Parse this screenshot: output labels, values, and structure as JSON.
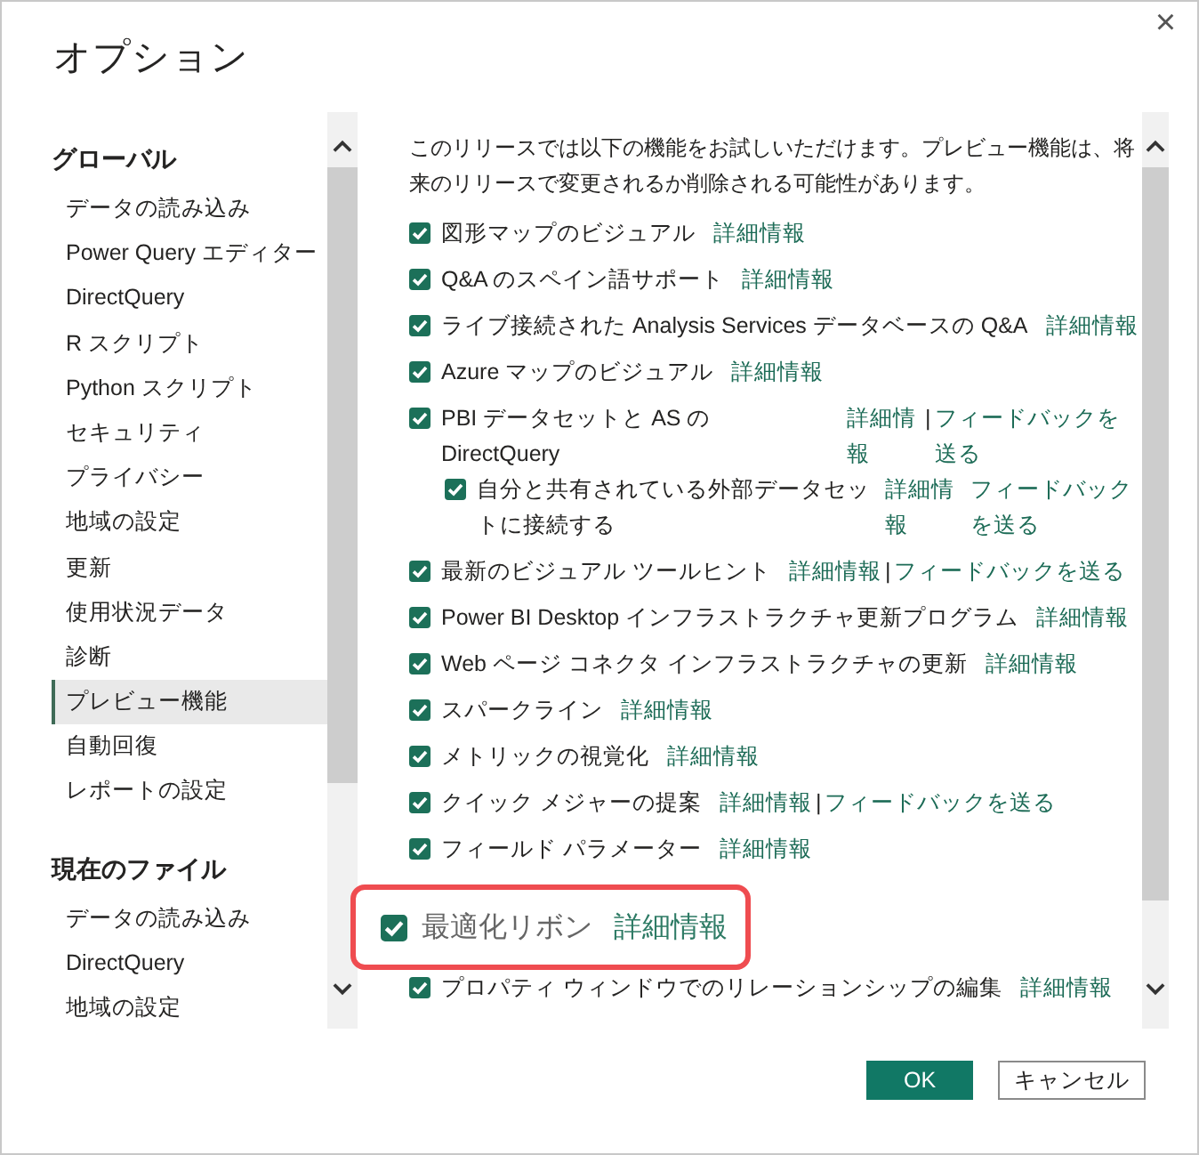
{
  "window": {
    "title": "オプション",
    "close": "×"
  },
  "sidebar": {
    "sections": [
      {
        "title": "グローバル",
        "items": [
          {
            "label": "データの読み込み",
            "selected": false
          },
          {
            "label": "Power Query エディター",
            "selected": false
          },
          {
            "label": "DirectQuery",
            "selected": false
          },
          {
            "label": "R スクリプト",
            "selected": false
          },
          {
            "label": "Python スクリプト",
            "selected": false
          },
          {
            "label": "セキュリティ",
            "selected": false
          },
          {
            "label": "プライバシー",
            "selected": false
          },
          {
            "label": "地域の設定",
            "selected": false
          },
          {
            "label": "更新",
            "selected": false
          },
          {
            "label": "使用状況データ",
            "selected": false
          },
          {
            "label": "診断",
            "selected": false
          },
          {
            "label": "プレビュー機能",
            "selected": true
          },
          {
            "label": "自動回復",
            "selected": false
          },
          {
            "label": "レポートの設定",
            "selected": false
          }
        ]
      },
      {
        "title": "現在のファイル",
        "items": [
          {
            "label": "データの読み込み",
            "selected": false
          },
          {
            "label": "DirectQuery",
            "selected": false
          },
          {
            "label": "地域の設定",
            "selected": false
          }
        ]
      }
    ]
  },
  "content": {
    "intro": "このリリースでは以下の機能をお試しいただけます。プレビュー機能は、将来のリリースで変更されるか削除される可能性があります。",
    "features": [
      {
        "label": "図形マップのビジュアル",
        "checked": true,
        "kind": "inline",
        "links": [
          "詳細情報"
        ]
      },
      {
        "label": "Q&A のスペイン語サポート",
        "checked": true,
        "kind": "inline",
        "links": [
          "詳細情報"
        ]
      },
      {
        "label": "ライブ接続された Analysis Services データベースの Q&A",
        "checked": true,
        "kind": "inline",
        "links": [
          "詳細情報"
        ]
      },
      {
        "label": "Azure マップのビジュアル",
        "checked": true,
        "kind": "inline",
        "links": [
          "詳細情報"
        ]
      },
      {
        "label": "PBI データセットと AS の DirectQuery",
        "checked": true,
        "kind": "columns",
        "links": [
          "詳細情報",
          "フィードバックを送る"
        ],
        "separator": "|",
        "children": [
          {
            "label": "自分と共有されている外部データセットに接続する",
            "checked": true,
            "kind": "columns",
            "links": [
              "詳細情報",
              "フィードバックを送る"
            ]
          }
        ]
      },
      {
        "label": "最新のビジュアル ツールヒント",
        "checked": true,
        "kind": "inline",
        "links": [
          "詳細情報",
          "フィードバックを送る"
        ],
        "separator": "|"
      },
      {
        "label": "Power BI Desktop インフラストラクチャ更新プログラム",
        "checked": true,
        "kind": "inline",
        "links": [
          "詳細情報"
        ]
      },
      {
        "label": "Web ページ コネクタ インフラストラクチャの更新",
        "checked": true,
        "kind": "inline",
        "links": [
          "詳細情報"
        ]
      },
      {
        "label": "スパークライン",
        "checked": true,
        "kind": "inline",
        "links": [
          "詳細情報"
        ]
      },
      {
        "label": "メトリックの視覚化",
        "checked": true,
        "kind": "inline",
        "links": [
          "詳細情報"
        ]
      },
      {
        "label": "クイック メジャーの提案",
        "checked": true,
        "kind": "inline",
        "links": [
          "詳細情報",
          "フィードバックを送る"
        ],
        "separator": "|"
      },
      {
        "label": "フィールド パラメーター",
        "checked": true,
        "kind": "inline",
        "links": [
          "詳細情報"
        ]
      },
      {
        "label": "最適化リボン",
        "checked": true,
        "kind": "highlight",
        "links": [
          "詳細情報"
        ]
      },
      {
        "label": "プロパティ ウィンドウでのリレーションシップの編集",
        "checked": true,
        "kind": "inline",
        "links": [
          "詳細情報"
        ]
      }
    ]
  },
  "buttons": [
    {
      "label": "OK",
      "kind": "primary"
    },
    {
      "label": "キャンセル",
      "kind": "secondary"
    }
  ]
}
